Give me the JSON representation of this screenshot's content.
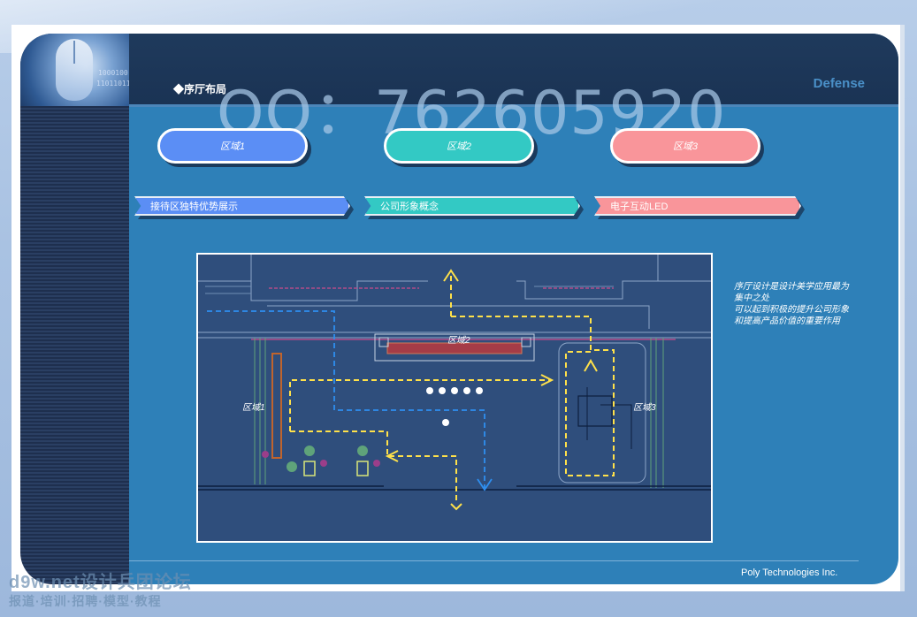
{
  "header": {
    "page_title": "◆序厅布局",
    "brand": "Defense"
  },
  "watermark": {
    "qq": "QQ：762605920",
    "forum": "d9w.net设计兵团论坛",
    "forum_sub": "报道·培训·招聘·模型·教程"
  },
  "sidebar": {
    "binary_1": "1000100",
    "binary_2": "11011011"
  },
  "zones": [
    {
      "label": "区域1",
      "color": "#5b8ef5"
    },
    {
      "label": "区域2",
      "color": "#33c9c4"
    },
    {
      "label": "区域3",
      "color": "#f9959a"
    }
  ],
  "tags": [
    {
      "label": "接待区独特优势展示",
      "color": "#5b8ef5"
    },
    {
      "label": "公司形象概念",
      "color": "#33c9c4"
    },
    {
      "label": "电子互动LED",
      "color": "#f9959a"
    }
  ],
  "floor_plan": {
    "zone_1": "区域1",
    "zone_2": "区域2",
    "zone_3": "区域3"
  },
  "side_note": "序厅设计是设计美学应用最为集中之处\n可以起到积极的提升公司形象和提高产品价值的重要作用",
  "footer": {
    "company": "Poly Technologies Inc."
  },
  "chart_data": {
    "type": "table",
    "title": "◆序厅布局",
    "categories": [
      "区域1",
      "区域2",
      "区域3"
    ],
    "series": [
      {
        "name": "",
        "values": [
          "接待区独特优势展示",
          "公司形象概念",
          "电子互动LED"
        ]
      }
    ]
  }
}
